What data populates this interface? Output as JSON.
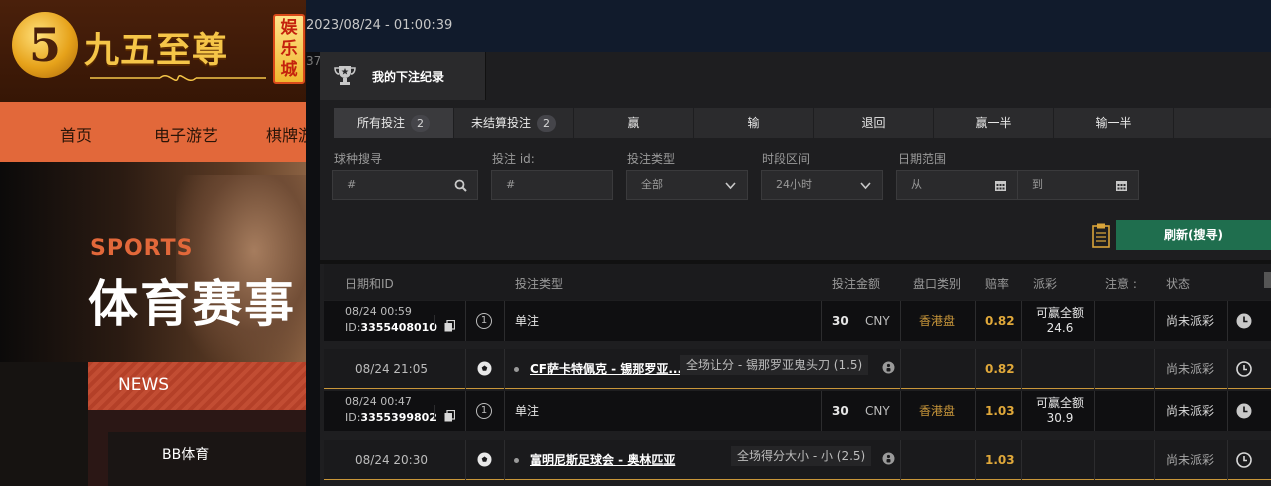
{
  "site": {
    "logo_text": "九五至尊",
    "logo_mark": "5",
    "logo_badge": "娱乐城",
    "nav": [
      "首页",
      "电子游艺",
      "棋牌游"
    ],
    "hero_eyebrow": "SPORTS",
    "hero_title": "体育赛事",
    "news_label": "NEWS",
    "news_item": "BB体育"
  },
  "app": {
    "timestamp": "2023/08/24 - 01:00:39",
    "bg_digits": "37",
    "panel_title": "我的下注纪录",
    "filter_tabs": [
      {
        "label": "所有投注",
        "count": "2",
        "active": true
      },
      {
        "label": "未结算投注",
        "count": "2",
        "active": false
      },
      {
        "label": "赢",
        "count": "",
        "active": false
      },
      {
        "label": "输",
        "count": "",
        "active": false
      },
      {
        "label": "退回",
        "count": "",
        "active": false
      },
      {
        "label": "赢一半",
        "count": "",
        "active": false
      },
      {
        "label": "输一半",
        "count": "",
        "active": false
      }
    ],
    "filters": {
      "sport_search": {
        "label": "球种搜寻",
        "placeholder": "#"
      },
      "bet_id": {
        "label": "投注 id:",
        "placeholder": "#"
      },
      "bet_type": {
        "label": "投注类型",
        "value": "全部"
      },
      "time_range": {
        "label": "时段区间",
        "value": "24小时"
      },
      "date_range": {
        "label": "日期范围",
        "from": "从",
        "to": "到"
      }
    },
    "refresh_label": "刷新(搜寻)",
    "table_headers": {
      "date_id": "日期和ID",
      "bet_type": "投注类型",
      "stake": "投注金额",
      "market": "盘口类别",
      "odds": "赔率",
      "payout": "派彩",
      "note": "注意 :",
      "status": "状态"
    },
    "bets": [
      {
        "date": "08/24 00:59",
        "id_prefix": "ID:",
        "id": "3355408010",
        "leg_count": "1",
        "type": "单注",
        "stake": "30",
        "currency": "CNY",
        "market": "香港盘",
        "odds": "0.82",
        "payout_label": "可赢全额",
        "payout_value": "24.6",
        "status": "尚未派彩",
        "leg": {
          "date": "08/24 21:05",
          "match": "CF萨卡特佩克 - 锡那罗亚...",
          "selection": "全场让分 - 锡那罗亚鬼头刀 (1.5)",
          "odds": "0.82",
          "status": "尚未派彩"
        }
      },
      {
        "date": "08/24 00:47",
        "id_prefix": "ID:",
        "id": "3355399802",
        "leg_count": "1",
        "type": "单注",
        "stake": "30",
        "currency": "CNY",
        "market": "香港盘",
        "odds": "1.03",
        "payout_label": "可赢全额",
        "payout_value": "30.9",
        "status": "尚未派彩",
        "leg": {
          "date": "08/24 20:30",
          "match": "富明尼斯足球会 - 奥林匹亚",
          "selection": "全场得分大小 - 小 (2.5)",
          "odds": "1.03",
          "status": "尚未派彩"
        }
      }
    ]
  },
  "colors": {
    "nav_orange": "#e2683a",
    "header_brown": "#4a200b",
    "refresh_green": "#1f6e4e",
    "odds_gold": "#e0a83a",
    "market_gold": "#c9973a"
  },
  "icons": [
    "trophy-icon",
    "search-icon",
    "chevron-down-icon",
    "calendar-icon",
    "clipboard-icon",
    "copy-icon",
    "clock-icon",
    "soccer-ball-icon",
    "info-icon"
  ]
}
